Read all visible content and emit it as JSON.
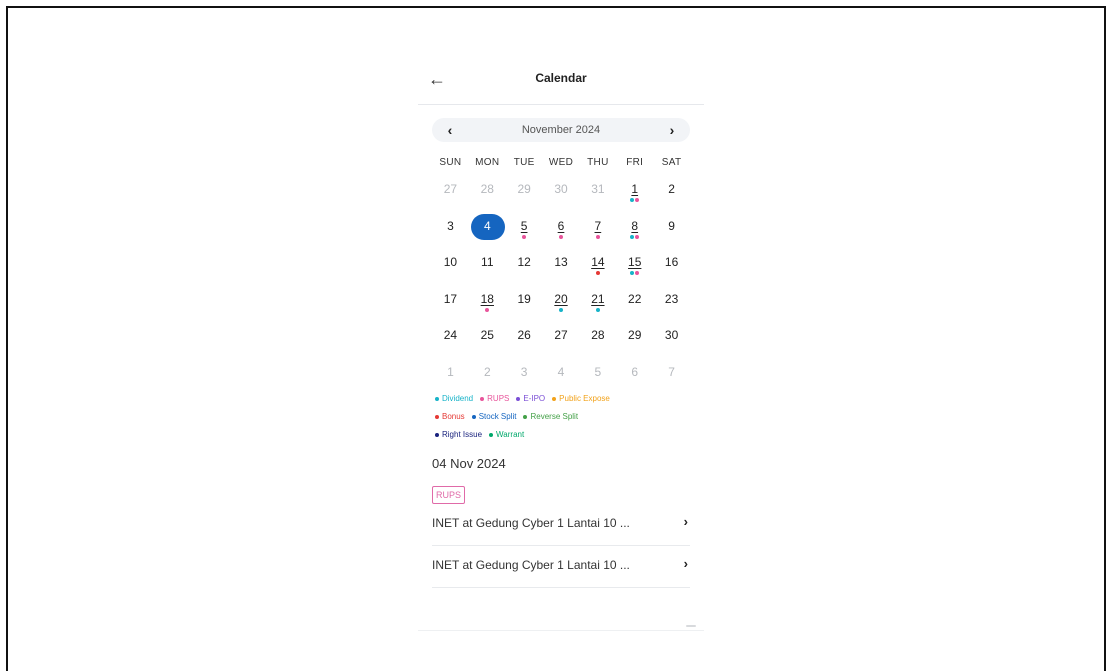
{
  "header": {
    "title": "Calendar",
    "back_icon": "arrow-left-icon"
  },
  "month_nav": {
    "label": "November 2024",
    "prev_icon": "chevron-left-icon",
    "next_icon": "chevron-right-icon"
  },
  "weekdays": [
    "SUN",
    "MON",
    "TUE",
    "WED",
    "THU",
    "FRI",
    "SAT"
  ],
  "colors": {
    "Dividend": "#17b3c8",
    "RUPS": "#e8559b",
    "E-IPO": "#7b4fd6",
    "Public Expose": "#f2a21a",
    "Bonus": "#e53935",
    "Stock Split": "#1565c0",
    "Reverse Split": "#43a047",
    "Right Issue": "#1a237e",
    "Warrant": "#00a86b",
    "selected": "#1565c0"
  },
  "days": [
    {
      "n": "27",
      "muted": true,
      "dots": []
    },
    {
      "n": "28",
      "muted": true,
      "dots": []
    },
    {
      "n": "29",
      "muted": true,
      "dots": []
    },
    {
      "n": "30",
      "muted": true,
      "dots": []
    },
    {
      "n": "31",
      "muted": true,
      "dots": []
    },
    {
      "n": "1",
      "underline": true,
      "dots": [
        "Dividend",
        "RUPS"
      ]
    },
    {
      "n": "2",
      "dots": []
    },
    {
      "n": "3",
      "dots": []
    },
    {
      "n": "4",
      "selected": true,
      "dots": []
    },
    {
      "n": "5",
      "underline": true,
      "dots": [
        "RUPS"
      ]
    },
    {
      "n": "6",
      "underline": true,
      "dots": [
        "RUPS"
      ]
    },
    {
      "n": "7",
      "underline": true,
      "dots": [
        "RUPS"
      ]
    },
    {
      "n": "8",
      "underline": true,
      "dots": [
        "Dividend",
        "RUPS"
      ]
    },
    {
      "n": "9",
      "dots": []
    },
    {
      "n": "10",
      "dots": []
    },
    {
      "n": "11",
      "dots": []
    },
    {
      "n": "12",
      "dots": []
    },
    {
      "n": "13",
      "dots": []
    },
    {
      "n": "14",
      "underline": true,
      "dots": [
        "Bonus"
      ]
    },
    {
      "n": "15",
      "underline": true,
      "dots": [
        "Dividend",
        "RUPS"
      ]
    },
    {
      "n": "16",
      "dots": []
    },
    {
      "n": "17",
      "dots": []
    },
    {
      "n": "18",
      "underline": true,
      "dots": [
        "RUPS"
      ]
    },
    {
      "n": "19",
      "dots": []
    },
    {
      "n": "20",
      "underline": true,
      "dots": [
        "Dividend"
      ]
    },
    {
      "n": "21",
      "underline": true,
      "dots": [
        "Dividend"
      ]
    },
    {
      "n": "22",
      "dots": []
    },
    {
      "n": "23",
      "dots": []
    },
    {
      "n": "24",
      "dots": []
    },
    {
      "n": "25",
      "dots": []
    },
    {
      "n": "26",
      "dots": []
    },
    {
      "n": "27",
      "dots": []
    },
    {
      "n": "28",
      "dots": []
    },
    {
      "n": "29",
      "dots": []
    },
    {
      "n": "30",
      "dots": []
    },
    {
      "n": "1",
      "muted": true,
      "dots": []
    },
    {
      "n": "2",
      "muted": true,
      "dots": []
    },
    {
      "n": "3",
      "muted": true,
      "dots": []
    },
    {
      "n": "4",
      "muted": true,
      "dots": []
    },
    {
      "n": "5",
      "muted": true,
      "dots": []
    },
    {
      "n": "6",
      "muted": true,
      "dots": []
    },
    {
      "n": "7",
      "muted": true,
      "dots": []
    }
  ],
  "legend": [
    [
      "Dividend",
      "RUPS",
      "E-IPO",
      "Public Expose"
    ],
    [
      "Bonus",
      "Stock Split",
      "Reverse Split"
    ],
    [
      "Right Issue",
      "Warrant"
    ]
  ],
  "selected": {
    "date_label": "04 Nov 2024",
    "tag": "RUPS",
    "events": [
      "INET at Gedung Cyber 1 Lantai 10 ...",
      "INET at Gedung Cyber 1 Lantai 10 ..."
    ]
  }
}
